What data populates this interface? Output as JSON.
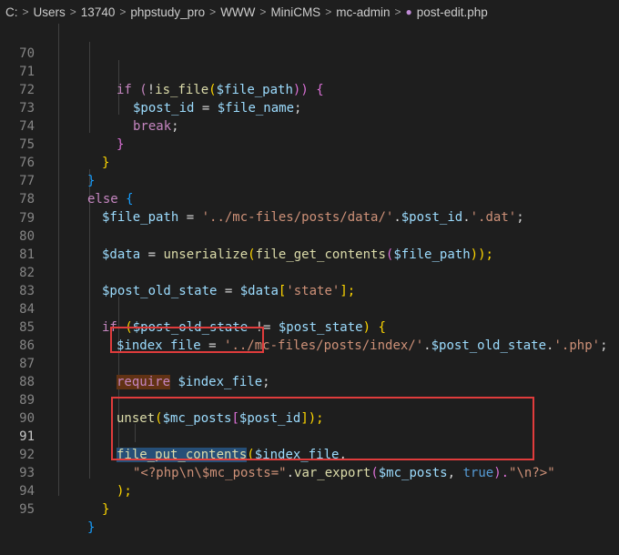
{
  "breadcrumb": {
    "items": [
      "C:",
      "Users",
      "13740",
      "phpstudy_pro",
      "WWW",
      "MiniCMS",
      "mc-admin"
    ],
    "file": "post-edit.php",
    "separator": ">"
  },
  "editor": {
    "active_line": "91",
    "lines": [
      {
        "n": "70"
      },
      {
        "n": "71",
        "t": [
          "if (",
          "!",
          "is_file",
          "(",
          "$file_path",
          ")) {"
        ]
      },
      {
        "n": "72",
        "t": [
          "$post_id",
          " = ",
          "$file_name",
          ";"
        ]
      },
      {
        "n": "73",
        "t": [
          "break",
          ";"
        ]
      },
      {
        "n": "74",
        "t": [
          "}"
        ]
      },
      {
        "n": "75",
        "t": [
          "}"
        ]
      },
      {
        "n": "76",
        "t": [
          "}"
        ]
      },
      {
        "n": "77",
        "t": [
          "else",
          " {"
        ]
      },
      {
        "n": "78",
        "t": [
          "$file_path",
          " = ",
          "'../mc-files/posts/data/'",
          ".",
          "$post_id",
          ".",
          "'.dat'",
          ";"
        ]
      },
      {
        "n": "79"
      },
      {
        "n": "80",
        "t": [
          "$data",
          " = ",
          "unserialize",
          "(",
          "file_get_contents",
          "(",
          "$file_path",
          "));"
        ]
      },
      {
        "n": "81"
      },
      {
        "n": "82",
        "t": [
          "$post_old_state",
          " = ",
          "$data",
          "[",
          "'state'",
          "];"
        ]
      },
      {
        "n": "83"
      },
      {
        "n": "84",
        "t": [
          "if",
          " (",
          "$post_old_state",
          " != ",
          "$post_state",
          ") {"
        ]
      },
      {
        "n": "85",
        "t": [
          "$index_file",
          " = ",
          "'../mc-files/posts/index/'",
          ".",
          "$post_old_state",
          ".",
          "'.php'",
          ";"
        ]
      },
      {
        "n": "86"
      },
      {
        "n": "87",
        "t": [
          "require",
          " ",
          "$index_file",
          ";"
        ]
      },
      {
        "n": "88"
      },
      {
        "n": "89",
        "t": [
          "unset",
          "(",
          "$mc_posts",
          "[",
          "$post_id",
          "]);"
        ]
      },
      {
        "n": "90"
      },
      {
        "n": "91",
        "t": [
          "file_put_contents",
          "(",
          "$index_file",
          ","
        ]
      },
      {
        "n": "92",
        "t": [
          "\"<?php\\n\\$mc_posts=\"",
          ".",
          "var_export",
          "(",
          "$mc_posts",
          ", ",
          "true",
          ").",
          "\"\\n?>\""
        ]
      },
      {
        "n": "93",
        "t": [
          ");"
        ]
      },
      {
        "n": "94",
        "t": [
          "}"
        ]
      },
      {
        "n": "95",
        "t": [
          "}"
        ]
      }
    ]
  },
  "colors": {
    "background": "#1e1e1e",
    "keyword": "#c586c0",
    "variable": "#9cdcfe",
    "function": "#dcdcaa",
    "string": "#ce9178",
    "annotation_box": "#e03c3c"
  }
}
